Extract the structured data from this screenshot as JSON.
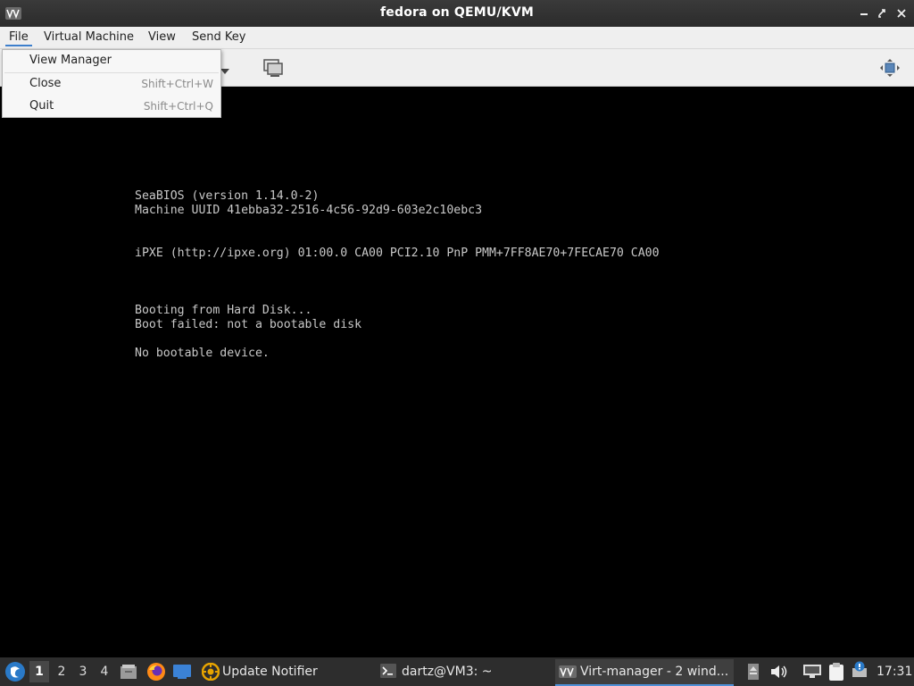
{
  "window": {
    "title": "fedora on QEMU/KVM",
    "icon": "virt-manager-icon",
    "controls": [
      "minimize-icon",
      "maximize-icon",
      "close-icon"
    ]
  },
  "menubar": {
    "items": [
      {
        "label": "File",
        "active": true
      },
      {
        "label": "Virtual Machine",
        "active": false
      },
      {
        "label": "View",
        "active": false
      },
      {
        "label": "Send Key",
        "active": false
      }
    ]
  },
  "file_menu": {
    "items": [
      {
        "label": "View Manager",
        "accel": ""
      },
      {
        "label": "Close",
        "accel": "Shift+Ctrl+W"
      },
      {
        "label": "Quit",
        "accel": "Shift+Ctrl+Q"
      }
    ]
  },
  "toolbar": {
    "icons": [
      "dropdown-arrow-icon",
      "screenshot-icon",
      "fullscreen-icon"
    ]
  },
  "console": {
    "lines": [
      "SeaBIOS (version 1.14.0-2)",
      "Machine UUID 41ebba32-2516-4c56-92d9-603e2c10ebc3",
      "",
      "",
      "iPXE (http://ipxe.org) 01:00.0 CA00 PCI2.10 PnP PMM+7FF8AE70+7FECAE70 CA00",
      "",
      "",
      "",
      "Booting from Hard Disk...",
      "Boot failed: not a bootable disk",
      "",
      "No bootable device."
    ]
  },
  "taskbar": {
    "workspaces": [
      "1",
      "2",
      "3",
      "4"
    ],
    "active_workspace": "1",
    "launchers": [
      "app-menu-icon",
      "file-manager-icon",
      "firefox-icon",
      "desktop-icon"
    ],
    "tasks": [
      {
        "label": "Update Notifier",
        "icon": "update-notifier-icon",
        "active": false
      },
      {
        "label": "dartz@VM3: ~",
        "icon": "terminal-icon",
        "active": false
      },
      {
        "label": "Virt-manager - 2 wind...",
        "icon": "virt-manager-icon",
        "active": true
      }
    ],
    "tray": [
      "removable-media-icon",
      "volume-icon",
      "network-icon",
      "clipboard-icon",
      "update-available-icon"
    ],
    "clock": "17:31"
  },
  "colors": {
    "menu_accent": "#3d7fcc",
    "console_text": "#c8c8c8",
    "taskbar_bg": "#2d2d2d"
  }
}
